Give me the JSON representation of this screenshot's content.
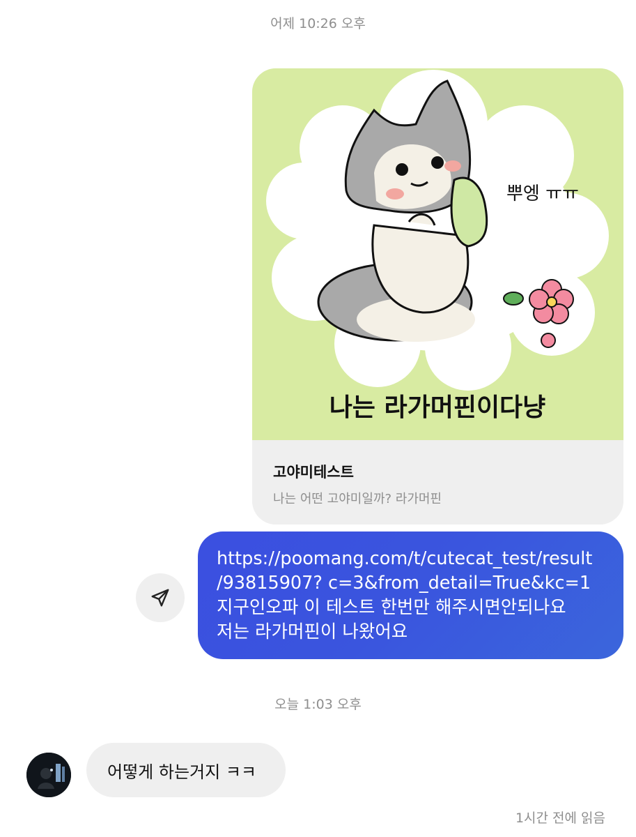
{
  "thread": {
    "timestamp_1": "어제 10:26 오후",
    "timestamp_2": "오늘 1:03 오후",
    "seen_status": "1시간 전에 읽음"
  },
  "link_card": {
    "image_bubble_text": "뿌엥 ㅠㅠ",
    "image_caption": "나는 라가머핀이다냥",
    "title": "고야미테스트",
    "subtitle": "나는 어떤 고야미일까?  라가머핀"
  },
  "sent_message": {
    "lines": [
      "https://poomang.com/t/cutecat_test/result",
      "/93815907? c=3&from_detail=True&kc=1",
      "지구인오파 이 테스트 한번만 해주시면안되나요",
      "저는 라가머핀이 나왔어요"
    ]
  },
  "received_message": {
    "text": "어떻게 하는거지 ㅋㅋ"
  },
  "icons": {
    "share": "paper-plane-icon",
    "avatar": "user-avatar"
  },
  "colors": {
    "sent_bubble": "#3b55de",
    "card_image_bg": "#d8eba2",
    "bubble_gray": "#efefef",
    "meta_text": "#8e8e8e"
  }
}
